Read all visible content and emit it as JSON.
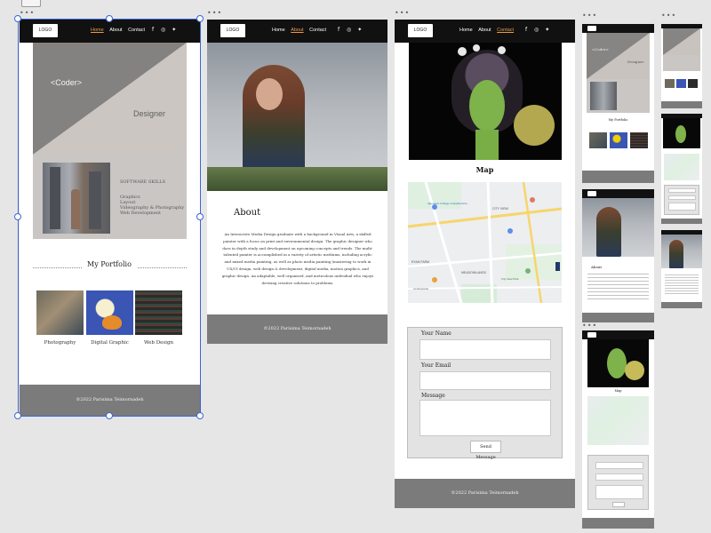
{
  "canvas": {
    "doc_icon": "document-icon",
    "frame_menu_glyph": "•••",
    "selection_color": "#3a66d9"
  },
  "site": {
    "logo": "LOGO",
    "nav": [
      "Home",
      "About",
      "Contact"
    ],
    "social_icons": [
      "facebook-icon",
      "instagram-icon",
      "twitter-icon"
    ],
    "social_glyphs": [
      "f",
      "◎",
      "✦"
    ],
    "footer": "©2022 Parisima Teimornadeh",
    "accent_color": "#e89a4a"
  },
  "home": {
    "hero_coder": "<Coder>",
    "hero_designer": "Designer",
    "skills_title": "SOFTWARE SKILLS",
    "skills": [
      "Graphics",
      "Layout",
      "Videography & Photography",
      "Web Development"
    ],
    "portfolio_title": "My Portfolio",
    "portfolio_items": [
      "Photography",
      "Digital Graphic",
      "Web Design"
    ]
  },
  "about": {
    "heading": "About",
    "body": "An Interactive Media Design graduate with a background in Visual Arts, a skilled painter with a focus on print and environmental design. The graphic designer who does in depth study and development on upcoming concepts and trends. The multi-talented painter is accomplished in a variety of artistic mediums, including acrylic and mixed media painting, as well as photo media painting (mastering to work in UX/UI design, web design & development, digital media, motion graphics, and graphic design. An adaptable, well organized, and meticulous individual who enjoys devising creative solutions to problems."
  },
  "contact": {
    "map_title": "Map",
    "map_labels": {
      "algonquin": "Algonquin College of Applied Arts...",
      "city_view": "CITY VIEW",
      "meadowlands": "MEADOWLANDS",
      "ryan_farm": "RYAN FARM",
      "city_park": "City View Park",
      "centrepointe": "Centrepointe"
    },
    "name_label": "Your Name",
    "email_label": "Your Email",
    "message_label": "Message",
    "send_button": "Send Message"
  },
  "mobile": {
    "coder": "<Coder>",
    "designer": "Designer",
    "portfolio_title": "My Portfolio",
    "about_title": "About",
    "map_title": "Map"
  }
}
